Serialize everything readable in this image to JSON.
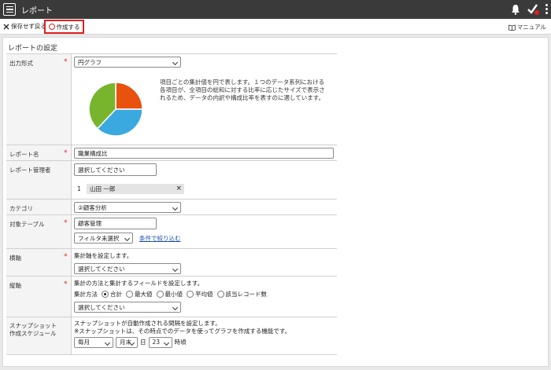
{
  "header": {
    "title": "レポート"
  },
  "toolbar": {
    "discard_label": "保存せず戻る",
    "create_label": "作成する",
    "manual_label": "マニュアル"
  },
  "section_title": "レポートの設定",
  "fields": {
    "output_format": {
      "label": "出力形式",
      "value": "円グラフ",
      "description": "項目ごとの集計値を円で表します。１つのデータ系列における各項目が、全項目の総和に対する比率に応じたサイズで表示されるため、データの内訳や構成比率を表すのに適しています。"
    },
    "report_name": {
      "label": "レポート名",
      "value": "職業構成比"
    },
    "report_manager": {
      "label": "レポート管理者",
      "placeholder": "選択してください",
      "item_no": "1",
      "item_name": "山田 一郎"
    },
    "category": {
      "label": "カテゴリ",
      "value": "②顧客分析"
    },
    "target_table": {
      "label": "対象テーブル",
      "value": "顧客管理",
      "filter_value": "フィルタ未選択",
      "filter_link": "条件で絞り込む"
    },
    "horizontal_axis": {
      "label": "横軸",
      "hint": "集計軸を設定します。",
      "placeholder": "選択してください"
    },
    "vertical_axis": {
      "label": "縦軸",
      "hint": "集計の方法と集計するフィールドを設定します。",
      "method_label": "集計方法",
      "options": [
        "合計",
        "最大値",
        "最小値",
        "平均値",
        "該当レコード数"
      ],
      "selected": "合計",
      "placeholder": "選択してください"
    },
    "snapshot": {
      "label_line1": "スナップショット",
      "label_line2": "作成スケジュール",
      "hint1": "スナップショットが自動作成される間隔を設定します。",
      "hint2": "※スナップショットは、その時点でのデータを使ってグラフを作成する機能です。",
      "freq": "毎月",
      "day": "月末",
      "day_suffix": "日",
      "hour": "23",
      "hour_suffix": "時頃"
    }
  },
  "pie_preview": {
    "slice_colors": [
      "#e8520e",
      "#3aa9e0",
      "#78b52d"
    ],
    "slice_values": [
      25,
      37,
      38
    ]
  }
}
